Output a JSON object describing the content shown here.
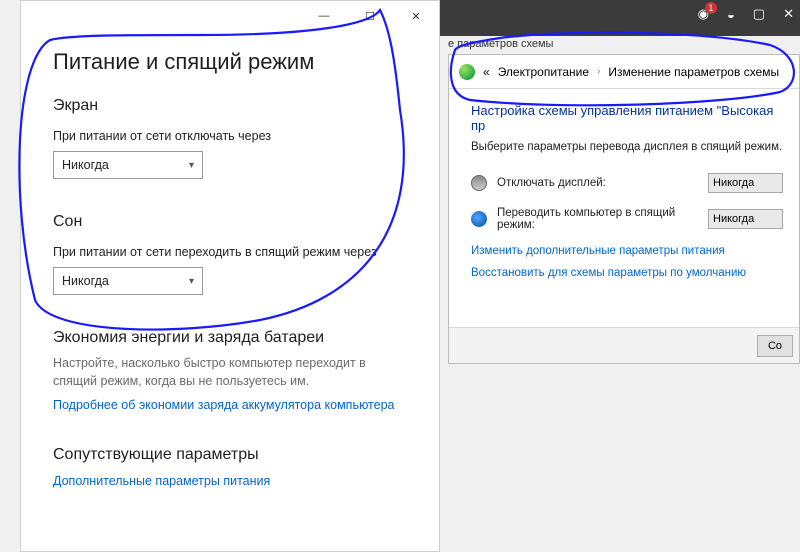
{
  "strip": {
    "caption": "е параметров схемы"
  },
  "settings": {
    "title": "Питание и спящий режим",
    "screen": {
      "heading": "Экран",
      "label": "При питании от сети отключать через",
      "value": "Никогда"
    },
    "sleep": {
      "heading": "Сон",
      "label": "При питании от сети переходить в спящий режим через",
      "value": "Никогда"
    },
    "eco": {
      "heading": "Экономия энергии и заряда батареи",
      "desc": "Настройте, насколько быстро компьютер переходит в спящий режим, когда вы не пользуетесь им.",
      "link": "Подробнее об экономии заряда аккумулятора компьютера"
    },
    "related": {
      "heading": "Сопутствующие параметры",
      "link": "Дополнительные параметры питания"
    }
  },
  "cp": {
    "crumb_back": "«",
    "crumb1": "Электропитание",
    "crumb2": "Изменение параметров схемы",
    "title": "Настройка схемы управления питанием \"Высокая пр",
    "sub": "Выберите параметры перевода дисплея в спящий режим.",
    "row_display": "Отключать дисплей:",
    "row_sleep": "Переводить компьютер в спящий режим:",
    "val_display": "Никогда",
    "val_sleep": "Никогда",
    "link1": "Изменить дополнительные параметры питания",
    "link2": "Восстановить для схемы параметры по умолчанию",
    "btn": "Со"
  }
}
